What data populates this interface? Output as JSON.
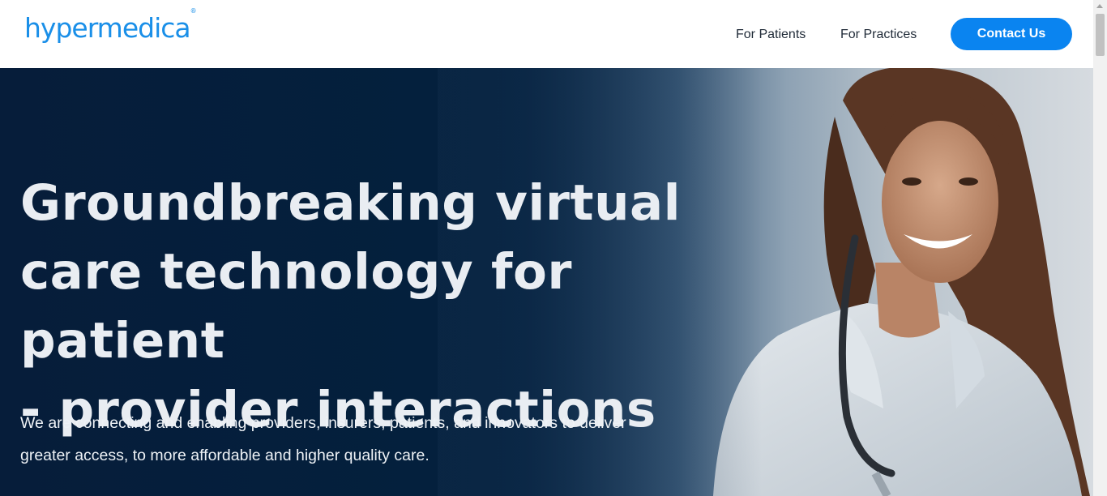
{
  "header": {
    "logo_text": "hypermedica",
    "logo_mark": "®",
    "nav": {
      "patients": "For Patients",
      "practices": "For Practices"
    },
    "contact_label": "Contact Us"
  },
  "hero": {
    "title_lines": [
      "Groundbreaking virtual",
      "care technology for patient",
      "- provider interactions"
    ],
    "subtitle_lines": [
      "We are connecting and enabling providers, insurers, patients, and innovators to deliver",
      "greater access, to more affordable and higher quality care."
    ],
    "image_subject": "smiling-doctor-with-stethoscope"
  },
  "colors": {
    "brand": "#1a8fe8",
    "button": "#0a84f0",
    "hero_dark": "#04203d",
    "hero_text": "#e9edf2"
  }
}
